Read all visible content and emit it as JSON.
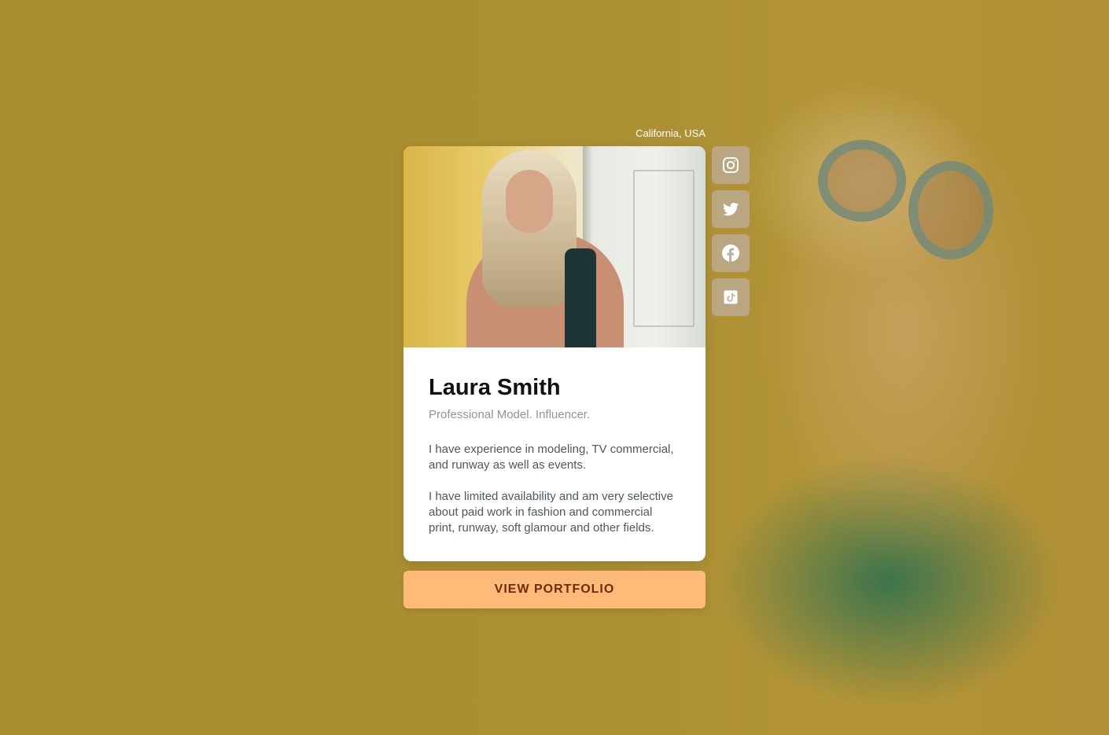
{
  "profile": {
    "location": "California, USA",
    "name": "Laura Smith",
    "tagline": "Professional Model. Influencer.",
    "bio": [
      "I have experience in modeling, TV commercial, and runway as well as events.",
      "I have limited availability and am very selective about paid work in fashion and commercial print, runway, soft glamour and other fields."
    ],
    "cta_label": "VIEW PORTFOLIO"
  },
  "social_links": [
    {
      "icon": "instagram-icon"
    },
    {
      "icon": "twitter-icon"
    },
    {
      "icon": "facebook-icon"
    },
    {
      "icon": "tiktok-icon"
    }
  ],
  "colors": {
    "background": "#ac9032",
    "card": "#ffffff",
    "cta_background": "#ffb978",
    "cta_text": "#6f2b05",
    "social_tile": "#beafa0"
  }
}
